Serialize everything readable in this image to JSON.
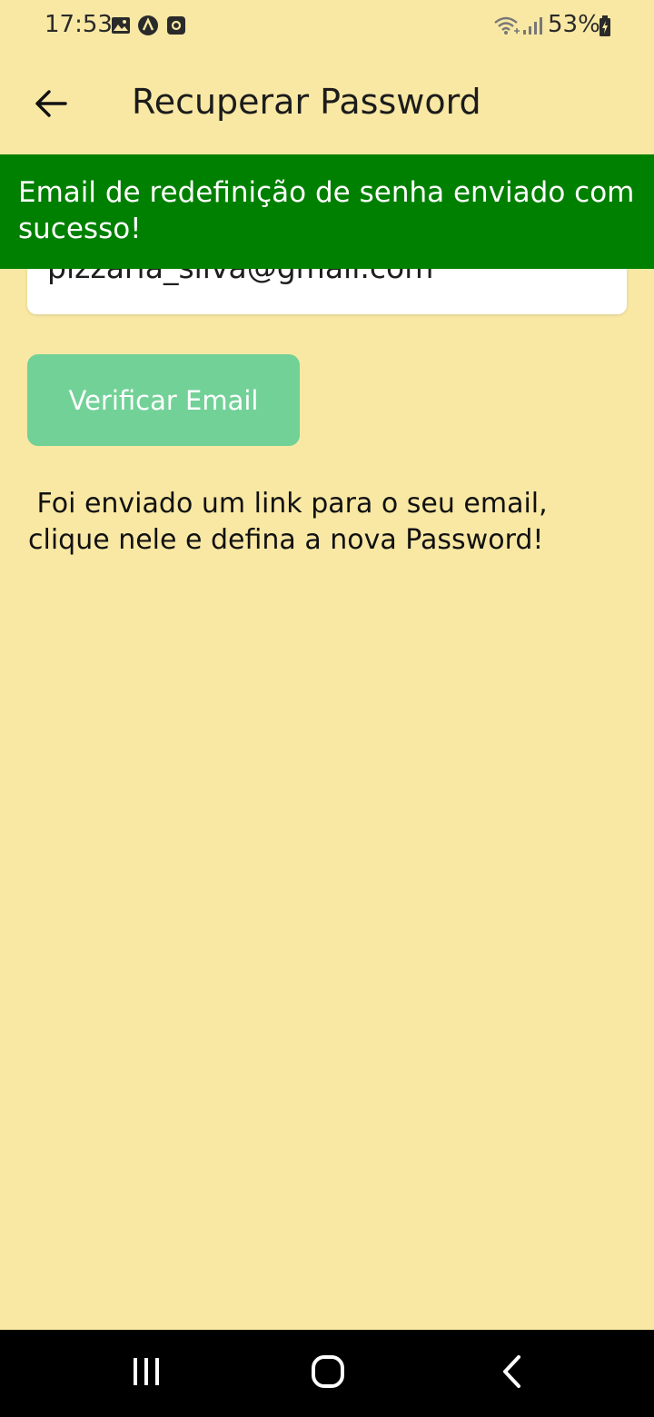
{
  "status_bar": {
    "time": "17:53",
    "battery": "53%",
    "left_icons": [
      "gallery-icon",
      "app-a-icon",
      "app-square-icon"
    ],
    "right_icons": [
      "wifi-icon",
      "signal-icon",
      "battery-icon"
    ]
  },
  "app_bar": {
    "title": "Recuperar Password",
    "back_icon": "arrow-back-icon"
  },
  "snackbar": {
    "message": "Email de redefinição de senha enviado com sucesso!",
    "color": "#008000"
  },
  "email_field": {
    "value": "pizzaria_silva@gmail.com"
  },
  "verify_button": {
    "label": "Verificar Email",
    "color": "#72d197"
  },
  "info": {
    "text": " Foi enviado um link para o seu email, clique nele e defina a nova Password!"
  },
  "nav_bar": {
    "icons": [
      "recent-apps-icon",
      "home-icon",
      "back-icon"
    ]
  },
  "colors": {
    "background": "#f8e8a4"
  }
}
